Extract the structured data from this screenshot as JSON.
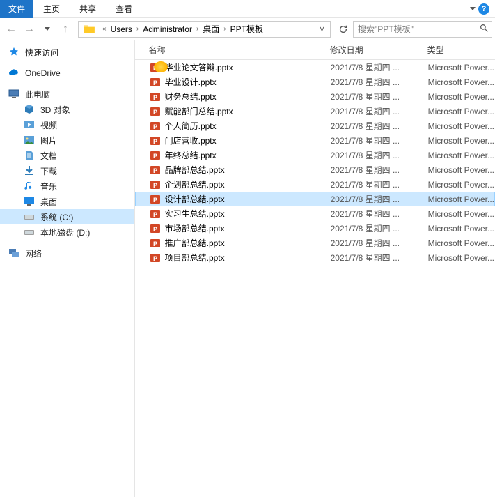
{
  "menubar": {
    "file": "文件",
    "home": "主页",
    "share": "共享",
    "view": "查看"
  },
  "breadcrumbs": [
    "Users",
    "Administrator",
    "桌面",
    "PPT模板"
  ],
  "search_placeholder": "搜索\"PPT模板\"",
  "sidebar": {
    "quick_access": "快速访问",
    "onedrive": "OneDrive",
    "this_pc": "此电脑",
    "items": [
      {
        "label": "3D 对象"
      },
      {
        "label": "视频"
      },
      {
        "label": "图片"
      },
      {
        "label": "文档"
      },
      {
        "label": "下载"
      },
      {
        "label": "音乐"
      },
      {
        "label": "桌面"
      },
      {
        "label": "系统 (C:)"
      },
      {
        "label": "本地磁盘 (D:)"
      }
    ],
    "network": "网络"
  },
  "columns": {
    "name": "名称",
    "date": "修改日期",
    "type": "类型"
  },
  "files": [
    {
      "name": "毕业论文答辩.pptx",
      "date": "2021/7/8 星期四 ...",
      "type": "Microsoft Power...",
      "selected": false
    },
    {
      "name": "毕业设计.pptx",
      "date": "2021/7/8 星期四 ...",
      "type": "Microsoft Power...",
      "selected": false
    },
    {
      "name": "财务总结.pptx",
      "date": "2021/7/8 星期四 ...",
      "type": "Microsoft Power...",
      "selected": false
    },
    {
      "name": "赋能部门总结.pptx",
      "date": "2021/7/8 星期四 ...",
      "type": "Microsoft Power...",
      "selected": false
    },
    {
      "name": "个人简历.pptx",
      "date": "2021/7/8 星期四 ...",
      "type": "Microsoft Power...",
      "selected": false
    },
    {
      "name": "门店营收.pptx",
      "date": "2021/7/8 星期四 ...",
      "type": "Microsoft Power...",
      "selected": false
    },
    {
      "name": "年终总结.pptx",
      "date": "2021/7/8 星期四 ...",
      "type": "Microsoft Power...",
      "selected": false
    },
    {
      "name": "品牌部总结.pptx",
      "date": "2021/7/8 星期四 ...",
      "type": "Microsoft Power...",
      "selected": false
    },
    {
      "name": "企划部总结.pptx",
      "date": "2021/7/8 星期四 ...",
      "type": "Microsoft Power...",
      "selected": false
    },
    {
      "name": "设计部总结.pptx",
      "date": "2021/7/8 星期四 ...",
      "type": "Microsoft Power...",
      "selected": true
    },
    {
      "name": "实习生总结.pptx",
      "date": "2021/7/8 星期四 ...",
      "type": "Microsoft Power...",
      "selected": false
    },
    {
      "name": "市场部总结.pptx",
      "date": "2021/7/8 星期四 ...",
      "type": "Microsoft Power...",
      "selected": false
    },
    {
      "name": "推广部总结.pptx",
      "date": "2021/7/8 星期四 ...",
      "type": "Microsoft Power...",
      "selected": false
    },
    {
      "name": "项目部总结.pptx",
      "date": "2021/7/8 星期四 ...",
      "type": "Microsoft Power...",
      "selected": false
    }
  ],
  "selected_sidebar": "系统 (C:)"
}
